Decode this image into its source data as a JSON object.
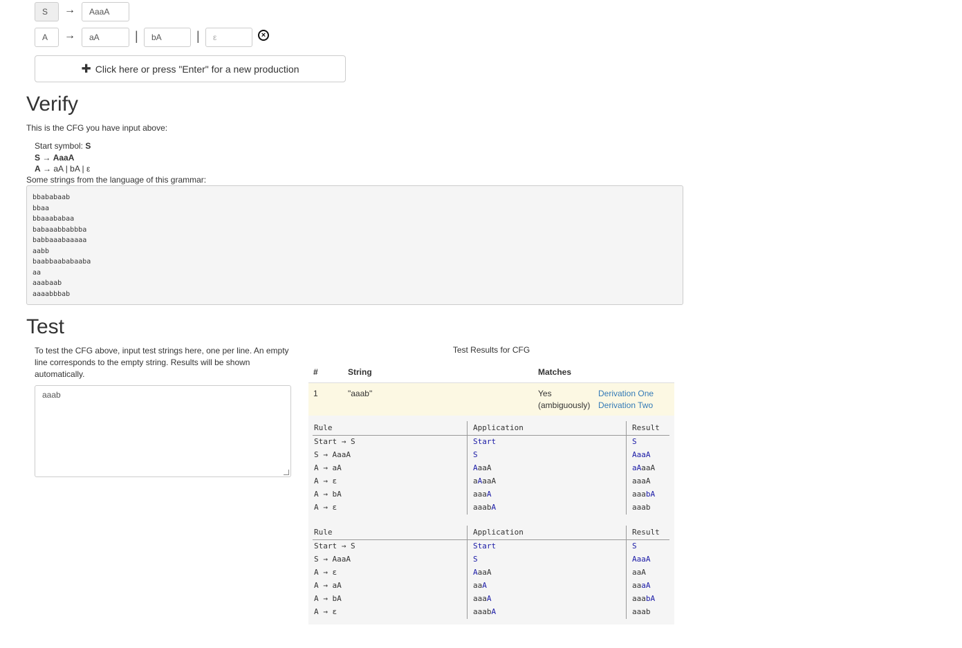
{
  "productions": {
    "p1": {
      "lhs": "S",
      "arrow": "→",
      "rhs": [
        "AaaA"
      ]
    },
    "p2": {
      "lhs": "A",
      "arrow": "→",
      "rhs": [
        "aA",
        "bA",
        "ε"
      ],
      "sep": "|"
    },
    "new_button": "Click here or press \"Enter\" for a new production"
  },
  "verify": {
    "title": "Verify",
    "intro": "This is the CFG you have input above:",
    "start_label": "Start symbol:",
    "start_symbol": "S",
    "rule1": {
      "lhs": "S",
      "arrow": "→",
      "rhs": "AaaA"
    },
    "rule2": {
      "lhs": "A",
      "arrow": "→",
      "alts": [
        "aA",
        "bA",
        "ε"
      ]
    },
    "strings_label": "Some strings from the language of this grammar:",
    "strings": [
      "bbababaab",
      "bbaa",
      "bbaaababaa",
      "babaaabbabbba",
      "babbaaabaaaaa",
      "aabb",
      "baabbaababaaba",
      "aa",
      "aaabaab",
      "aaaabbbab"
    ]
  },
  "test": {
    "title": "Test",
    "info": "To test the CFG above, input test strings here, one per line. An empty line corresponds to the empty string. Results will be shown automatically.",
    "input_value": "aaab",
    "results_title": "Test Results for CFG",
    "columns": [
      "#",
      "String",
      "Matches"
    ],
    "row": {
      "num": "1",
      "string": "\"aaab\"",
      "match1": "Yes",
      "match2": "(ambiguously)",
      "link1": "Derivation One",
      "link2": "Derivation Two"
    }
  },
  "derivations": {
    "headers": [
      "Rule",
      "Application",
      "Result"
    ],
    "one": [
      {
        "rule": "Start → S",
        "app": [
          "",
          "Start",
          ""
        ],
        "res": [
          "",
          "S",
          ""
        ]
      },
      {
        "rule": "S → AaaA",
        "app": [
          "",
          "S",
          ""
        ],
        "res": [
          "",
          "AaaA",
          ""
        ]
      },
      {
        "rule": "A → aA",
        "app": [
          "",
          "A",
          "aaA"
        ],
        "res": [
          "",
          "aA",
          "aaA"
        ]
      },
      {
        "rule": "A → ε",
        "app": [
          "a",
          "A",
          "aaA"
        ],
        "res": [
          "aaaA",
          "",
          ""
        ]
      },
      {
        "rule": "A → bA",
        "app": [
          "aaa",
          "A",
          ""
        ],
        "res": [
          "aaa",
          "bA",
          ""
        ]
      },
      {
        "rule": "A → ε",
        "app": [
          "aaab",
          "A",
          ""
        ],
        "res": [
          "aaab",
          "",
          ""
        ]
      }
    ],
    "two": [
      {
        "rule": "Start → S",
        "app": [
          "",
          "Start",
          ""
        ],
        "res": [
          "",
          "S",
          ""
        ]
      },
      {
        "rule": "S → AaaA",
        "app": [
          "",
          "S",
          ""
        ],
        "res": [
          "",
          "AaaA",
          ""
        ]
      },
      {
        "rule": "A → ε",
        "app": [
          "",
          "A",
          "aaA"
        ],
        "res": [
          "aaA",
          "",
          ""
        ]
      },
      {
        "rule": "A → aA",
        "app": [
          "aa",
          "A",
          ""
        ],
        "res": [
          "aa",
          "aA",
          ""
        ]
      },
      {
        "rule": "A → bA",
        "app": [
          "aaa",
          "A",
          ""
        ],
        "res": [
          "aaa",
          "bA",
          ""
        ]
      },
      {
        "rule": "A → ε",
        "app": [
          "aaab",
          "A",
          ""
        ],
        "res": [
          "aaab",
          "",
          ""
        ]
      }
    ]
  }
}
